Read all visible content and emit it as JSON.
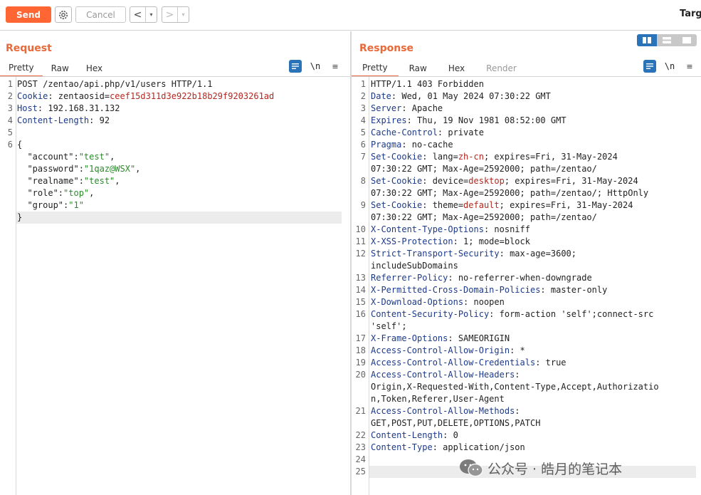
{
  "toolbar": {
    "send_label": "Send",
    "cancel_label": "Cancel",
    "back_label": "<",
    "forward_label": ">",
    "dropdown_label": "▾",
    "target_label": "Targe"
  },
  "request": {
    "title": "Request",
    "tabs": [
      "Pretty",
      "Raw",
      "Hex"
    ],
    "active_tab": "Pretty",
    "newline_label": "\\n",
    "menu_label": "≡",
    "lines": [
      {
        "n": "1",
        "text": "POST /zentao/api.php/v1/users HTTP/1.1"
      },
      {
        "n": "2",
        "key": "Cookie",
        "text": ": zentaosid=",
        "val": "ceef15d311d3e922b18b29f9203261ad"
      },
      {
        "n": "3",
        "key": "Host",
        "text": ": 192.168.31.132"
      },
      {
        "n": "4",
        "key": "Content-Length",
        "text": ": 92"
      },
      {
        "n": "5",
        "text": ""
      },
      {
        "n": "6",
        "text": "{"
      },
      {
        "n": "",
        "text": "  \"account\":\"test\","
      },
      {
        "n": "",
        "text": "  \"password\":\"1qaz@WSX\","
      },
      {
        "n": "",
        "text": "  \"realname\":\"test\","
      },
      {
        "n": "",
        "text": "  \"role\":\"top\","
      },
      {
        "n": "",
        "text": "  \"group\":\"1\""
      },
      {
        "n": "",
        "text": "}"
      }
    ]
  },
  "response": {
    "title": "Response",
    "tabs": [
      "Pretty",
      "Raw",
      "Hex",
      "Render"
    ],
    "active_tab": "Pretty",
    "newline_label": "\\n",
    "menu_label": "≡",
    "lines": [
      {
        "n": "1",
        "text": "HTTP/1.1 403 Forbidden"
      },
      {
        "n": "2",
        "key": "Date",
        "text": ": Wed, 01 May 2024 07:30:22 GMT"
      },
      {
        "n": "3",
        "key": "Server",
        "text": ": Apache"
      },
      {
        "n": "4",
        "key": "Expires",
        "text": ": Thu, 19 Nov 1981 08:52:00 GMT"
      },
      {
        "n": "5",
        "key": "Cache-Control",
        "text": ": private"
      },
      {
        "n": "6",
        "key": "Pragma",
        "text": ": no-cache"
      },
      {
        "n": "7",
        "key": "Set-Cookie",
        "text": ": lang=",
        "val": "zh-cn",
        "rest": "; expires=Fri, 31-May-2024"
      },
      {
        "n": "",
        "text": "07:30:22 GMT; Max-Age=2592000; path=/zentao/"
      },
      {
        "n": "8",
        "key": "Set-Cookie",
        "text": ": device=",
        "val": "desktop",
        "rest": "; expires=Fri, 31-May-2024"
      },
      {
        "n": "",
        "text": "07:30:22 GMT; Max-Age=2592000; path=/zentao/; HttpOnly"
      },
      {
        "n": "9",
        "key": "Set-Cookie",
        "text": ": theme=",
        "val": "default",
        "rest": "; expires=Fri, 31-May-2024"
      },
      {
        "n": "",
        "text": "07:30:22 GMT; Max-Age=2592000; path=/zentao/"
      },
      {
        "n": "10",
        "key": "X-Content-Type-Options",
        "text": ": nosniff"
      },
      {
        "n": "11",
        "key": "X-XSS-Protection",
        "text": ": 1; mode=block"
      },
      {
        "n": "12",
        "key": "Strict-Transport-Security",
        "text": ": max-age=3600;"
      },
      {
        "n": "",
        "text": "includeSubDomains"
      },
      {
        "n": "13",
        "key": "Referrer-Policy",
        "text": ": no-referrer-when-downgrade"
      },
      {
        "n": "14",
        "key": "X-Permitted-Cross-Domain-Policies",
        "text": ": master-only"
      },
      {
        "n": "15",
        "key": "X-Download-Options",
        "text": ": noopen"
      },
      {
        "n": "16",
        "key": "Content-Security-Policy",
        "text": ": form-action 'self';connect-src"
      },
      {
        "n": "",
        "text": "'self';"
      },
      {
        "n": "17",
        "key": "X-Frame-Options",
        "text": ": SAMEORIGIN"
      },
      {
        "n": "18",
        "key": "Access-Control-Allow-Origin",
        "text": ": *"
      },
      {
        "n": "19",
        "key": "Access-Control-Allow-Credentials",
        "text": ": true"
      },
      {
        "n": "20",
        "key": "Access-Control-Allow-Headers",
        "text": ":"
      },
      {
        "n": "",
        "text": "Origin,X-Requested-With,Content-Type,Accept,Authorizatio"
      },
      {
        "n": "",
        "text": "n,Token,Referer,User-Agent"
      },
      {
        "n": "21",
        "key": "Access-Control-Allow-Methods",
        "text": ":"
      },
      {
        "n": "",
        "text": "GET,POST,PUT,DELETE,OPTIONS,PATCH"
      },
      {
        "n": "22",
        "key": "Content-Length",
        "text": ": 0"
      },
      {
        "n": "23",
        "key": "Content-Type",
        "text": ": application/json"
      },
      {
        "n": "24",
        "text": ""
      },
      {
        "n": "25",
        "text": ""
      }
    ]
  },
  "watermark": {
    "text": "公众号 · 皓月的笔记本"
  },
  "colors": {
    "accent": "#ff6633",
    "title": "#e8693a",
    "header_key": "#1d3a8a",
    "cookie_value": "#b5271f",
    "json_string": "#2a8a2a",
    "active_icon": "#2b73b8"
  }
}
